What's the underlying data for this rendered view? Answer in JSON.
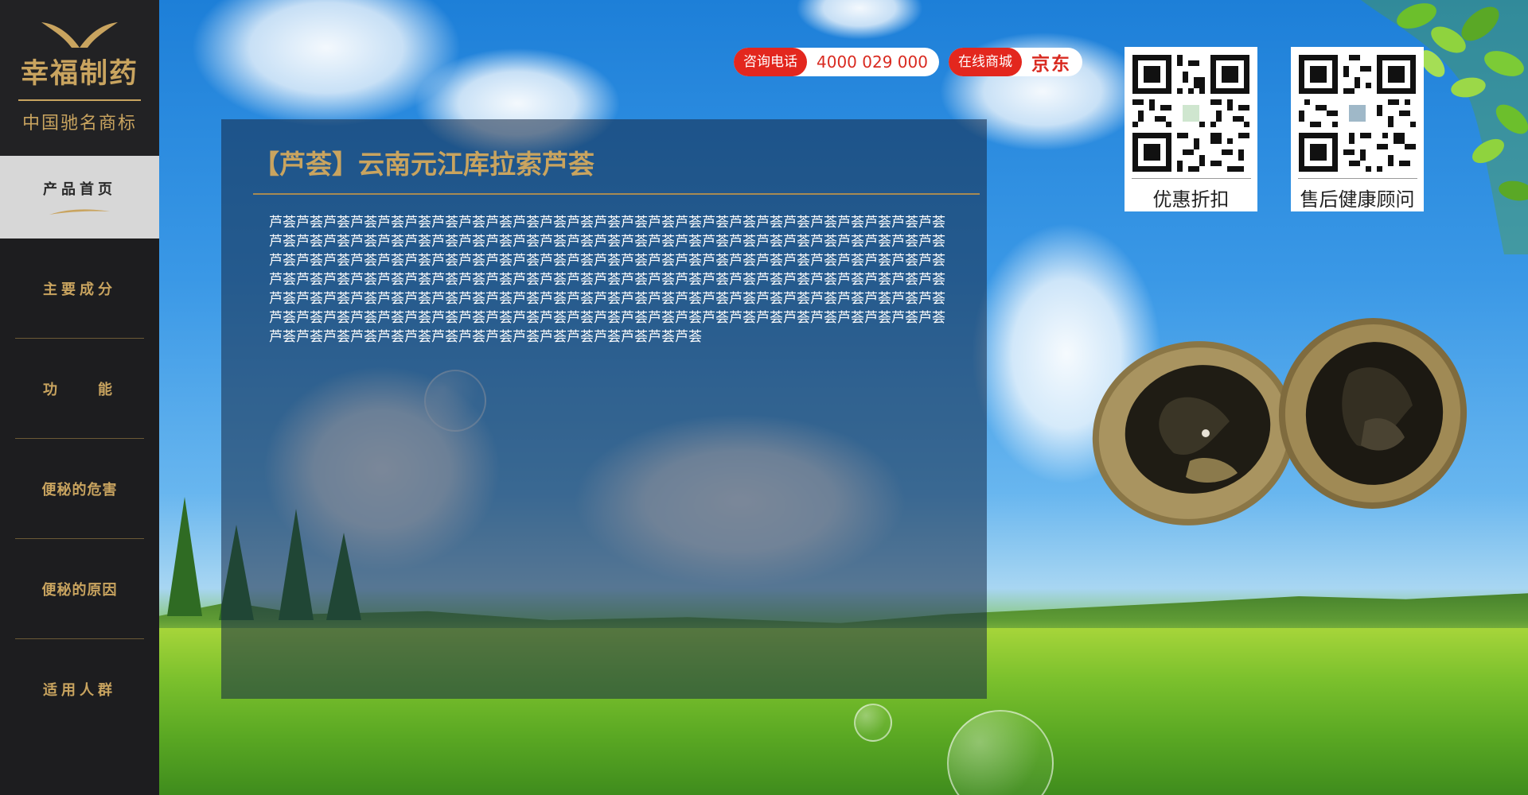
{
  "brand": {
    "name": "幸福制药",
    "slogan": "中国驰名商标"
  },
  "sidebar": {
    "items": [
      {
        "label": "产品首页",
        "active": true
      },
      {
        "label": "主要成分",
        "active": false
      },
      {
        "label": "功　　能",
        "active": false
      },
      {
        "label": "便秘的危害",
        "active": false
      },
      {
        "label": "便秘的原因",
        "active": false
      },
      {
        "label": "适用人群",
        "active": false
      }
    ]
  },
  "contact": {
    "phone_tag": "咨询电话",
    "phone": "4000 029 000",
    "shop_tag": "在线商城",
    "shop": "京东"
  },
  "qr": [
    {
      "label": "优惠折扣"
    },
    {
      "label": "售后健康顾问"
    }
  ],
  "panel": {
    "title": "【芦荟】云南元江库拉索芦荟",
    "body": "芦荟芦荟芦荟芦荟芦荟芦荟芦荟芦荟芦荟芦荟芦荟芦荟芦荟芦荟芦荟芦荟芦荟芦荟芦荟芦荟芦荟芦荟芦荟芦荟芦荟芦荟芦荟芦荟芦荟芦荟芦荟芦荟芦荟芦荟芦荟芦荟芦荟芦荟芦荟芦荟芦荟芦荟芦荟芦荟芦荟芦荟芦荟芦荟芦荟芦荟芦荟芦荟芦荟芦荟芦荟芦荟芦荟芦荟芦荟芦荟芦荟芦荟芦荟芦荟芦荟芦荟芦荟芦荟芦荟芦荟芦荟芦荟芦荟芦荟芦荟芦荟芦荟芦荟芦荟芦荟芦荟芦荟芦荟芦荟芦荟芦荟芦荟芦荟芦荟芦荟芦荟芦荟芦荟芦荟芦荟芦荟芦荟芦荟芦荟芦荟芦荟芦荟芦荟芦荟芦荟芦荟芦荟芦荟芦荟芦荟芦荟芦荟芦荟芦荟芦荟芦荟芦荟芦荟芦荟芦荟芦荟芦荟芦荟芦荟芦荟芦荟芦荟芦荟芦荟芦荟芦荟芦荟芦荟芦荟芦荟芦荟芦荟芦荟芦荟芦荟芦荟芦荟芦荟芦荟芦荟芦荟芦荟芦荟芦荟芦荟芦荟芦荟芦荟芦荟芦荟芦荟芦荟芦荟芦荟芦荟芦荟芦荟芦荟芦荟芦荟芦荟"
  },
  "colors": {
    "gold": "#c9a45f",
    "sidebar_bg": "#1d1d1f",
    "accent_red": "#e3271e"
  }
}
